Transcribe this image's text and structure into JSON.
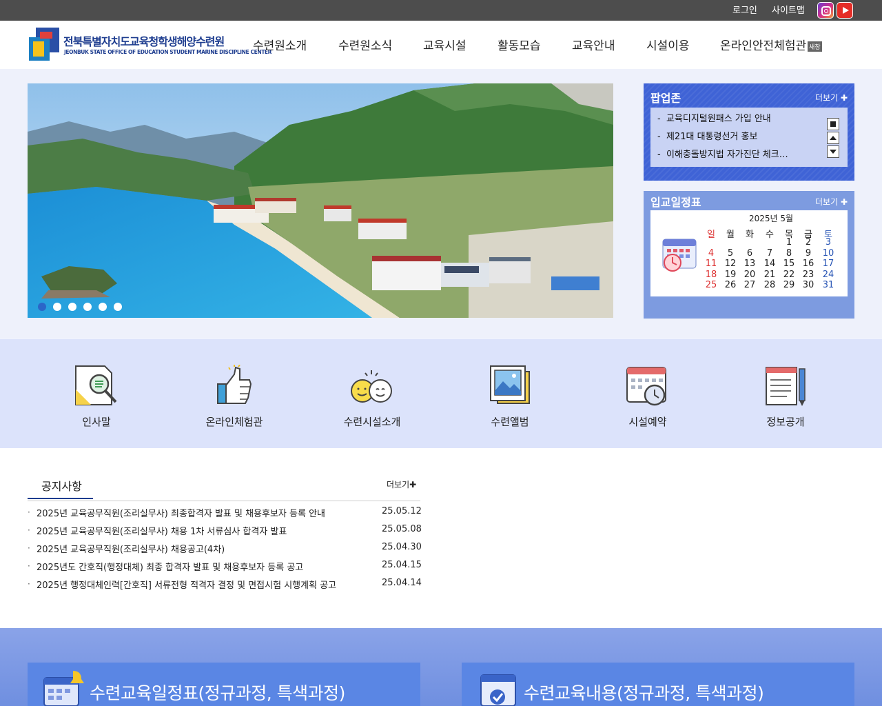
{
  "topbar": {
    "login": "로그인",
    "sitemap": "사이트맵",
    "sns": [
      "instagram-icon",
      "youtube-icon"
    ]
  },
  "header": {
    "logo_title": "전북특별자치도교육청학생해양수련원",
    "logo_sub": "JEONBUK STATE OFFICE OF EDUCATION STUDENT MARINE DISCIPLINE CENTER",
    "nav": [
      "수련원소개",
      "수련원소식",
      "교육시설",
      "활동모습",
      "교육안내",
      "시설이용",
      "온라인안전체험관"
    ],
    "nav_badge": "새창"
  },
  "slider": {
    "dots": 6,
    "active": 0
  },
  "popup": {
    "title": "팝업존",
    "more": "더보기",
    "items": [
      "교육디지털원패스 가입 안내",
      "제21대 대통령선거 홍보",
      "이해충돌방지법 자가진단 체크리스트"
    ]
  },
  "schedule": {
    "title": "입교일정표",
    "more": "더보기",
    "month": "2025년 5월",
    "weekdays": [
      "일",
      "월",
      "화",
      "수",
      "목",
      "금",
      "토"
    ],
    "weeks": [
      [
        "",
        "",
        "",
        "",
        "1",
        "2",
        "3"
      ],
      [
        "4",
        "5",
        "6",
        "7",
        "8",
        "9",
        "10"
      ],
      [
        "11",
        "12",
        "13",
        "14",
        "15",
        "16",
        "17"
      ],
      [
        "18",
        "19",
        "20",
        "21",
        "22",
        "23",
        "24"
      ],
      [
        "25",
        "26",
        "27",
        "28",
        "29",
        "30",
        "31"
      ]
    ]
  },
  "quick": [
    {
      "label": "인사말",
      "icon": "greeting-icon"
    },
    {
      "label": "온라인체험관",
      "icon": "thumbs-up-icon"
    },
    {
      "label": "수련시설소개",
      "icon": "smiley-icon"
    },
    {
      "label": "수련앨범",
      "icon": "photo-album-icon"
    },
    {
      "label": "시설예약",
      "icon": "calendar-clock-icon"
    },
    {
      "label": "정보공개",
      "icon": "notepad-icon"
    }
  ],
  "notice": {
    "title": "공지사항",
    "more": "더보기",
    "items": [
      {
        "title": "2025년 교육공무직원(조리실무사) 최종합격자 발표 및 채용후보자 등록 안내",
        "date": "25.05.12"
      },
      {
        "title": "2025년 교육공무직원(조리실무사) 채용 1차 서류심사 합격자 발표",
        "date": "25.05.08"
      },
      {
        "title": "2025년 교육공무직원(조리실무사) 채용공고(4차)",
        "date": "25.04.30"
      },
      {
        "title": "2025년도 간호직(행정대체) 최종 합격자 발표 및 채용후보자 등록 공고",
        "date": "25.04.15"
      },
      {
        "title": "2025년 행정대체인력[간호직] 서류전형 적격자 결정 및 면접시험 시행계획 공고",
        "date": "25.04.14"
      }
    ]
  },
  "banners": [
    {
      "title": "수련교육일정표(정규과정, 특색과정)",
      "icon": "calendar-bell-icon"
    },
    {
      "title": "수련교육내용(정규과정, 특색과정)",
      "icon": "calendar-check-icon"
    }
  ]
}
